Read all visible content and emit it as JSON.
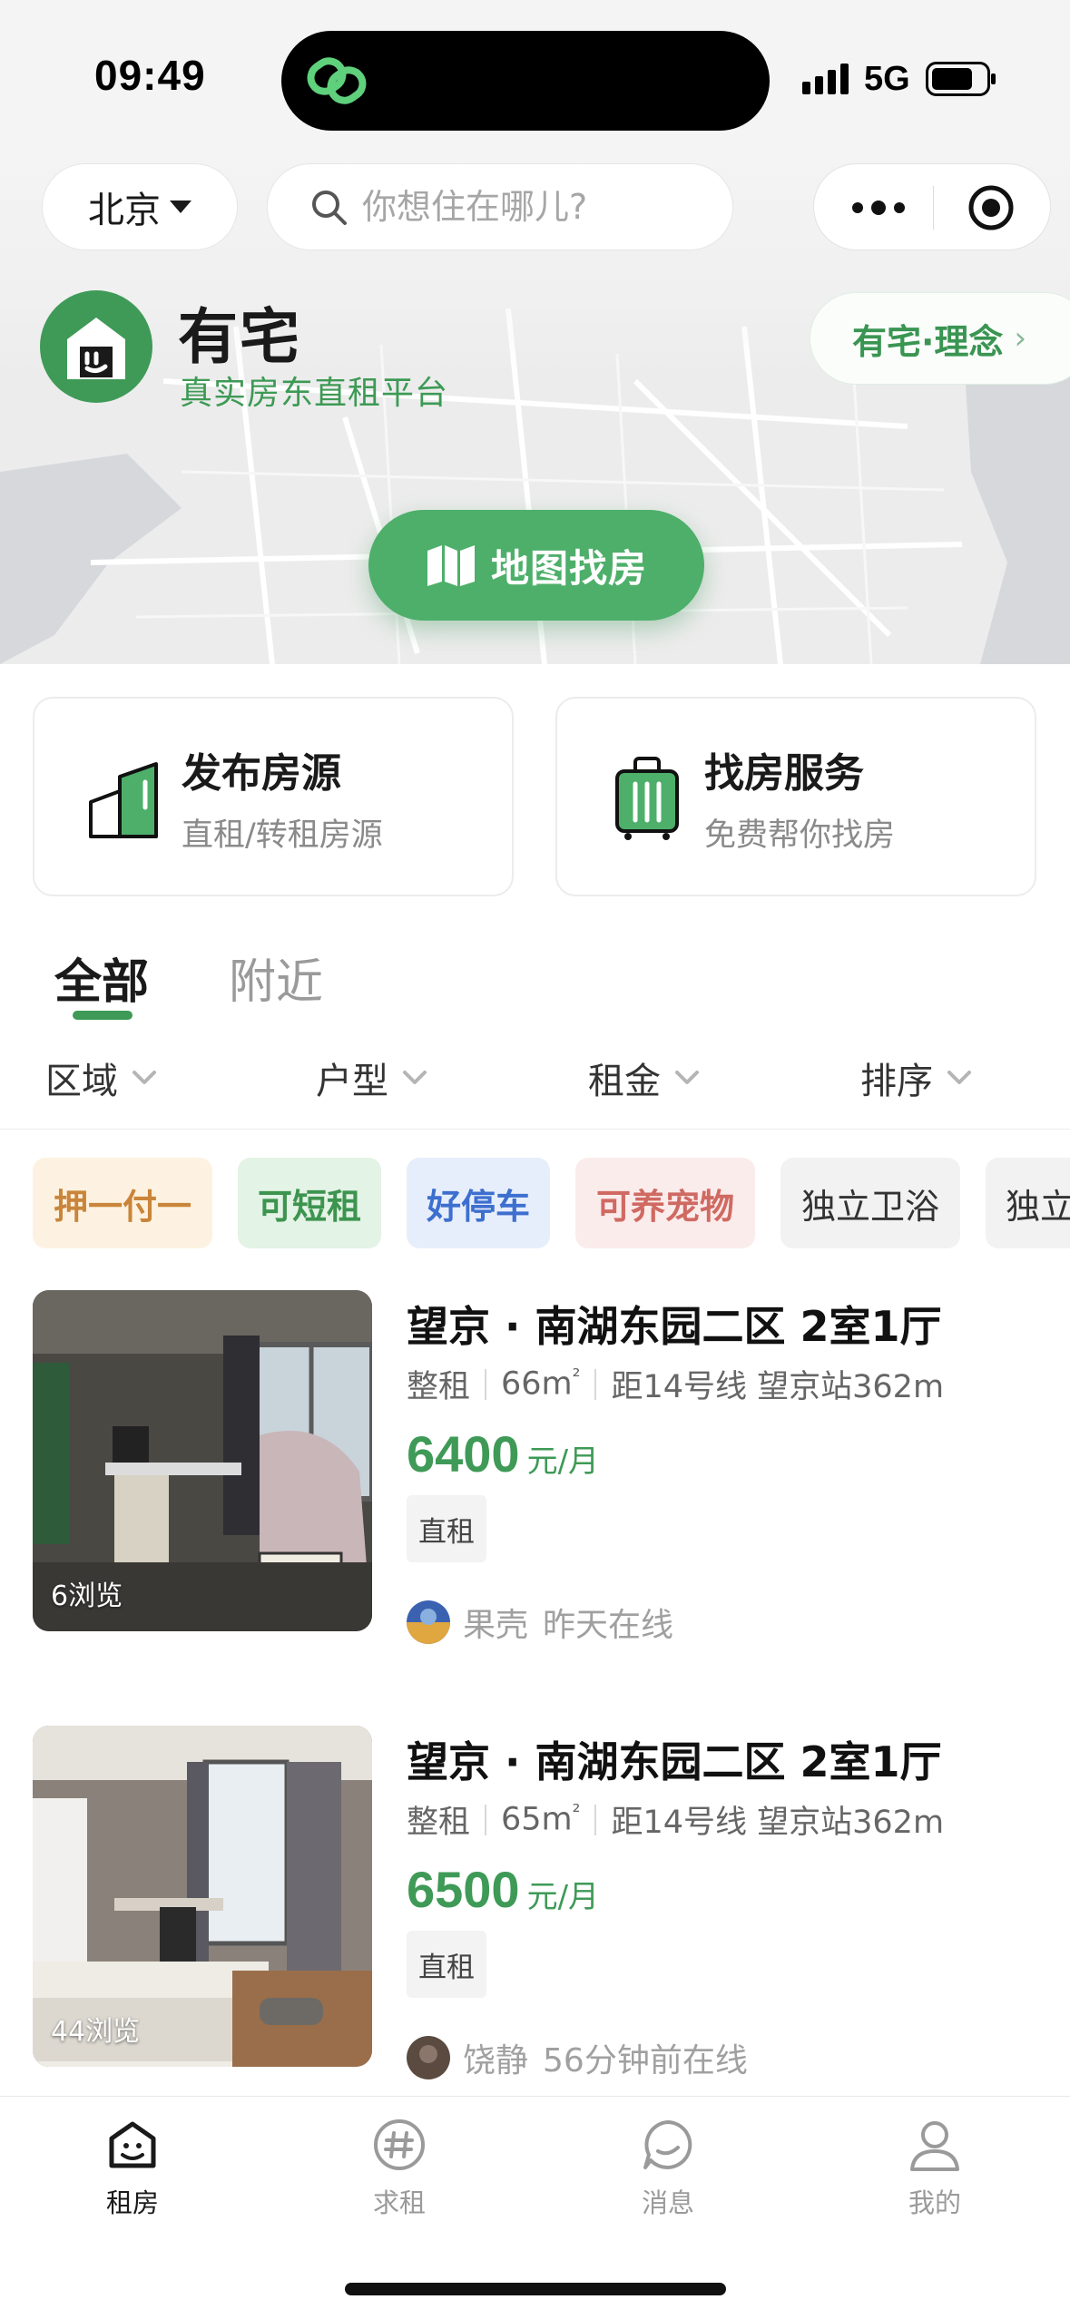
{
  "status_bar": {
    "time": "09:49",
    "network": "5G"
  },
  "top_bar": {
    "city": "北京",
    "search_placeholder": "你想住在哪儿?"
  },
  "brand": {
    "name": "有宅",
    "tagline": "真实房东直租平台",
    "concept_label": "有宅·理念",
    "concept_arrow": "›"
  },
  "map_button_label": "地图找房",
  "services": [
    {
      "title": "发布房源",
      "subtitle": "直租/转租房源"
    },
    {
      "title": "找房服务",
      "subtitle": "免费帮你找房"
    }
  ],
  "tabs": [
    {
      "label": "全部",
      "active": true
    },
    {
      "label": "附近",
      "active": false
    }
  ],
  "filters": [
    "区域",
    "户型",
    "租金",
    "排序"
  ],
  "chips": [
    "押一付一",
    "可短租",
    "好停车",
    "可养宠物",
    "独立卫浴",
    "独立"
  ],
  "listings": [
    {
      "title": "望京 · 南湖东园二区 2室1厅",
      "rent_type": "整租",
      "area": "66m",
      "area_unit_sup": "²",
      "transit": "距14号线 望京站362m",
      "price": "6400",
      "price_unit": "元/月",
      "tag": "直租",
      "views": "6浏览",
      "owner": "果壳",
      "owner_status": "昨天在线"
    },
    {
      "title": "望京 · 南湖东园二区 2室1厅",
      "rent_type": "整租",
      "area": "65m",
      "area_unit_sup": "²",
      "transit": "距14号线 望京站362m",
      "price": "6500",
      "price_unit": "元/月",
      "tag": "直租",
      "views": "44浏览",
      "owner": "饶静",
      "owner_status": "56分钟前在线"
    }
  ],
  "tab_bar": [
    {
      "label": "租房",
      "icon": "home-icon",
      "active": true
    },
    {
      "label": "求租",
      "icon": "hash-icon",
      "active": false
    },
    {
      "label": "消息",
      "icon": "chat-icon",
      "active": false
    },
    {
      "label": "我的",
      "icon": "user-icon",
      "active": false
    }
  ],
  "colors": {
    "brand_green": "#3e9a56",
    "map_button": "#4daf6a",
    "text_primary": "#1a1a1a",
    "text_secondary": "#8a8a8a"
  }
}
